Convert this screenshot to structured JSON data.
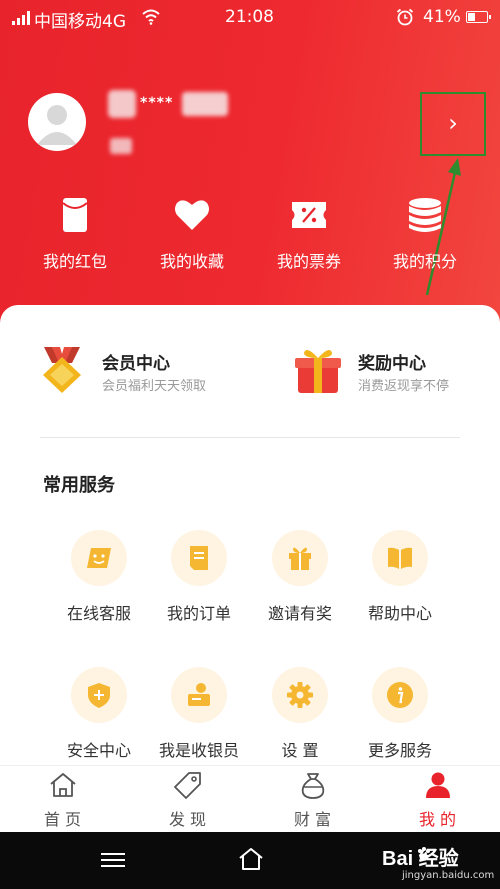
{
  "status_bar": {
    "carrier": "中国移动4G",
    "time": "21:08",
    "battery": "41%"
  },
  "profile": {
    "username_masked": "****",
    "arrow_glyph": "›"
  },
  "quick_actions": [
    {
      "label": "我的红包",
      "icon": "red-envelope-icon"
    },
    {
      "label": "我的收藏",
      "icon": "heart-icon"
    },
    {
      "label": "我的票券",
      "icon": "coupon-icon"
    },
    {
      "label": "我的积分",
      "icon": "coins-stack-icon"
    }
  ],
  "promos": [
    {
      "title": "会员中心",
      "subtitle": "会员福利天天领取",
      "icon": "medal-icon"
    },
    {
      "title": "奖励中心",
      "subtitle": "消费返现享不停",
      "icon": "gift-box-icon"
    }
  ],
  "services": {
    "title": "常用服务",
    "items": [
      {
        "label": "在线客服",
        "icon": "chat-icon"
      },
      {
        "label": "我的订单",
        "icon": "order-icon"
      },
      {
        "label": "邀请有奖",
        "icon": "gift-icon"
      },
      {
        "label": "帮助中心",
        "icon": "book-icon"
      },
      {
        "label": "安全中心",
        "icon": "shield-icon"
      },
      {
        "label": "我是收银员",
        "icon": "cashier-icon"
      },
      {
        "label": "设 置",
        "icon": "gear-icon"
      },
      {
        "label": "更多服务",
        "icon": "info-icon"
      }
    ]
  },
  "tabs": [
    {
      "label": "首 页",
      "icon": "home-icon"
    },
    {
      "label": "发 现",
      "icon": "tag-icon"
    },
    {
      "label": "财 富",
      "icon": "money-bag-icon"
    },
    {
      "label": "我 的",
      "icon": "person-icon",
      "active": true
    }
  ],
  "watermark": {
    "brand": "Bai  经验",
    "site": "jingyan.baidu.com"
  },
  "colors": {
    "primary": "#e8232b",
    "service_icon": "#f5b731",
    "service_bg": "#fff4e2",
    "annotation": "#2e8b2e"
  }
}
